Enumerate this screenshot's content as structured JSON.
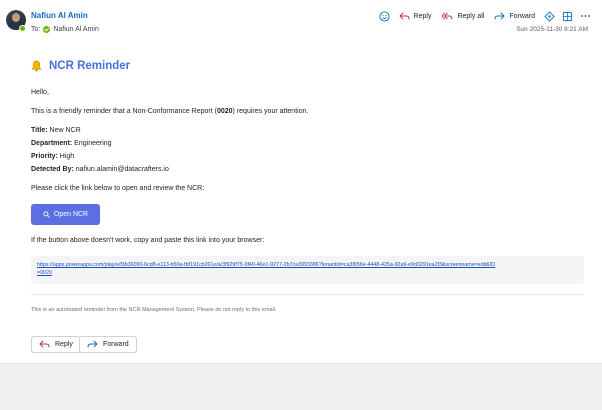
{
  "header": {
    "sender_name": "Nafiun Al Amin",
    "to_label": "To:",
    "to_name": "Nafiun Al Amin",
    "date": "Sun 2025-11-30 8:21 AM",
    "actions": {
      "reply": "Reply",
      "reply_all": "Reply all",
      "forward": "Forward"
    },
    "icons": [
      "emoji-icon",
      "reply-icon",
      "reply-all-icon",
      "forward-icon",
      "apps-icon",
      "grid-icon",
      "more-icon"
    ]
  },
  "email": {
    "title": "NCR Reminder",
    "greeting": "Hello,",
    "intro_before": "This is a friendly reminder that a Non-Conformance Report (",
    "report_number": "0020",
    "intro_after": ") requires your attention.",
    "fields": [
      {
        "label": "Title:",
        "value": " New NCR"
      },
      {
        "label": "Department:",
        "value": " Engineering"
      },
      {
        "label": "Priority:",
        "value": " High"
      },
      {
        "label": "Detected By:",
        "value": " nafiun.alamin@datacrafters.io"
      }
    ],
    "click_prompt": "Please click the link below to open and review the NCR:",
    "open_button": "Open NCR",
    "fallback_text": "If the button above doesn't work, copy and paste this link into your browser:",
    "link_line1": "https://apps.powerapps.com/play/e/f3b36090-6cd8-e113-b50a-fbf191cb261e/a/3f929f75-9f40-46e1-9277-2b7ca3993386?tenantId=ca3f056e-4448-425a-92a9-e9d3291ea2f3&screenname=edit&ID",
    "link_line2": "=0020",
    "footnote": "This is an automated reminder from the NCR Management System. Please do not reply to this email."
  },
  "footer_actions": {
    "reply": "Reply",
    "forward": "Forward"
  },
  "colors": {
    "accent": "#4a6fdc",
    "button": "#5b6fe0",
    "link": "#1a4fc4",
    "sender": "#0f6cbd"
  }
}
